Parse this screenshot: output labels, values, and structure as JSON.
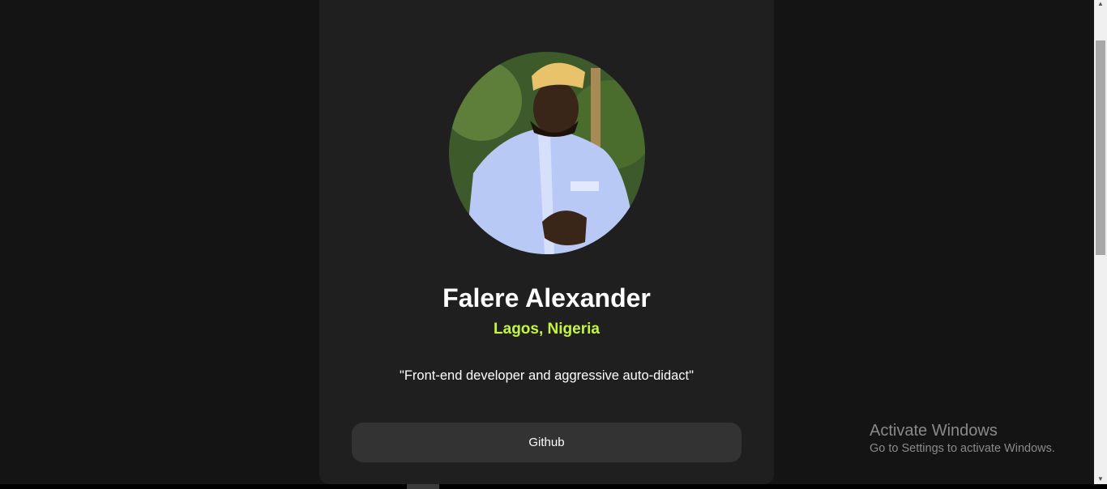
{
  "profile": {
    "name": "Falere Alexander",
    "location": "Lagos, Nigeria",
    "bio": "\"Front-end developer and aggressive auto-didact\""
  },
  "links": [
    {
      "label": "Github"
    }
  ],
  "watermark": {
    "title": "Activate Windows",
    "subtitle": "Go to Settings to activate Windows."
  },
  "colors": {
    "accent": "#c5f82a",
    "card": "#1f1f1f",
    "background": "#141414",
    "button": "#333333"
  }
}
